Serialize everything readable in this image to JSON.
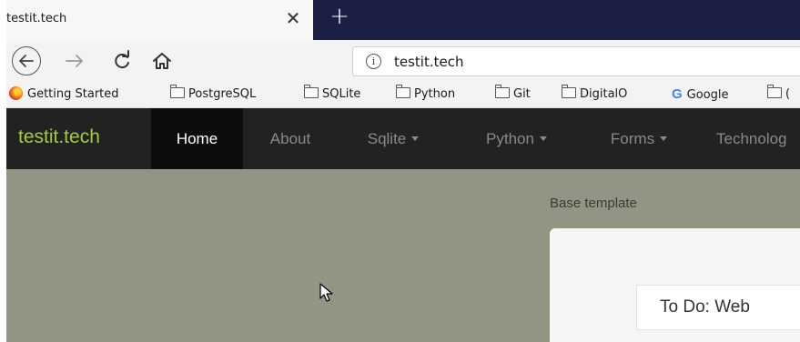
{
  "browser": {
    "tab": {
      "title": "testit.tech",
      "close_glyph": "✕"
    },
    "new_tab_glyph": "+",
    "toolbar": {
      "back_icon": "back-arrow-icon",
      "forward_icon": "forward-arrow-icon",
      "reload_icon": "reload-icon",
      "home_icon": "home-icon",
      "info_glyph": "i",
      "url": "testit.tech"
    },
    "bookmarks": [
      {
        "label": "Getting Started",
        "icon": "firefox-icon"
      },
      {
        "label": "PostgreSQL",
        "icon": "folder-icon"
      },
      {
        "label": "SQLite",
        "icon": "folder-icon"
      },
      {
        "label": "Python",
        "icon": "folder-icon"
      },
      {
        "label": "Git",
        "icon": "folder-icon"
      },
      {
        "label": "DigitalO",
        "icon": "folder-icon"
      },
      {
        "label": "Google",
        "icon": "google-icon"
      },
      {
        "label": "(",
        "icon": "folder-icon"
      }
    ]
  },
  "site": {
    "brand": "testit.tech",
    "nav": [
      {
        "label": "Home",
        "active": true,
        "dropdown": false
      },
      {
        "label": "About",
        "active": false,
        "dropdown": false
      },
      {
        "label": "Sqlite",
        "active": false,
        "dropdown": true
      },
      {
        "label": "Python",
        "active": false,
        "dropdown": true
      },
      {
        "label": "Forms",
        "active": false,
        "dropdown": true
      },
      {
        "label": "Technolog",
        "active": false,
        "dropdown": false
      }
    ],
    "body": {
      "heading": "Base template",
      "todo_label": "To Do: Web"
    }
  },
  "colors": {
    "brand_green": "#a2cc3a",
    "navbar_bg": "#222222",
    "page_bg": "#929583",
    "tabstrip_bg": "#1c1f44"
  }
}
